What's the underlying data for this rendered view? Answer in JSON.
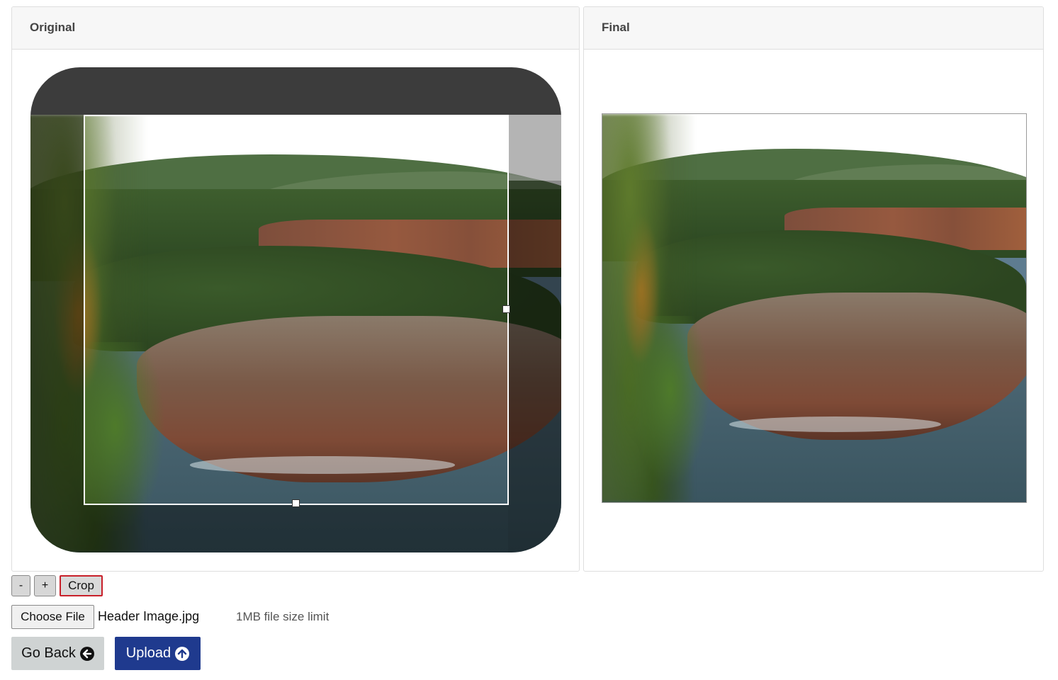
{
  "panels": {
    "original": {
      "title": "Original"
    },
    "final": {
      "title": "Final"
    }
  },
  "controls": {
    "zoom_out_label": "-",
    "zoom_in_label": "+",
    "crop_label": "Crop"
  },
  "file": {
    "choose_label": "Choose File",
    "file_name": "Header Image.jpg",
    "size_limit": "1MB file size limit"
  },
  "actions": {
    "back_label": "Go Back",
    "back_icon": "arrow-left-circle-icon",
    "upload_label": "Upload",
    "upload_icon": "arrow-up-circle-icon"
  },
  "colors": {
    "upload_bg": "#1f3a8e",
    "crop_border": "#c8202a"
  }
}
